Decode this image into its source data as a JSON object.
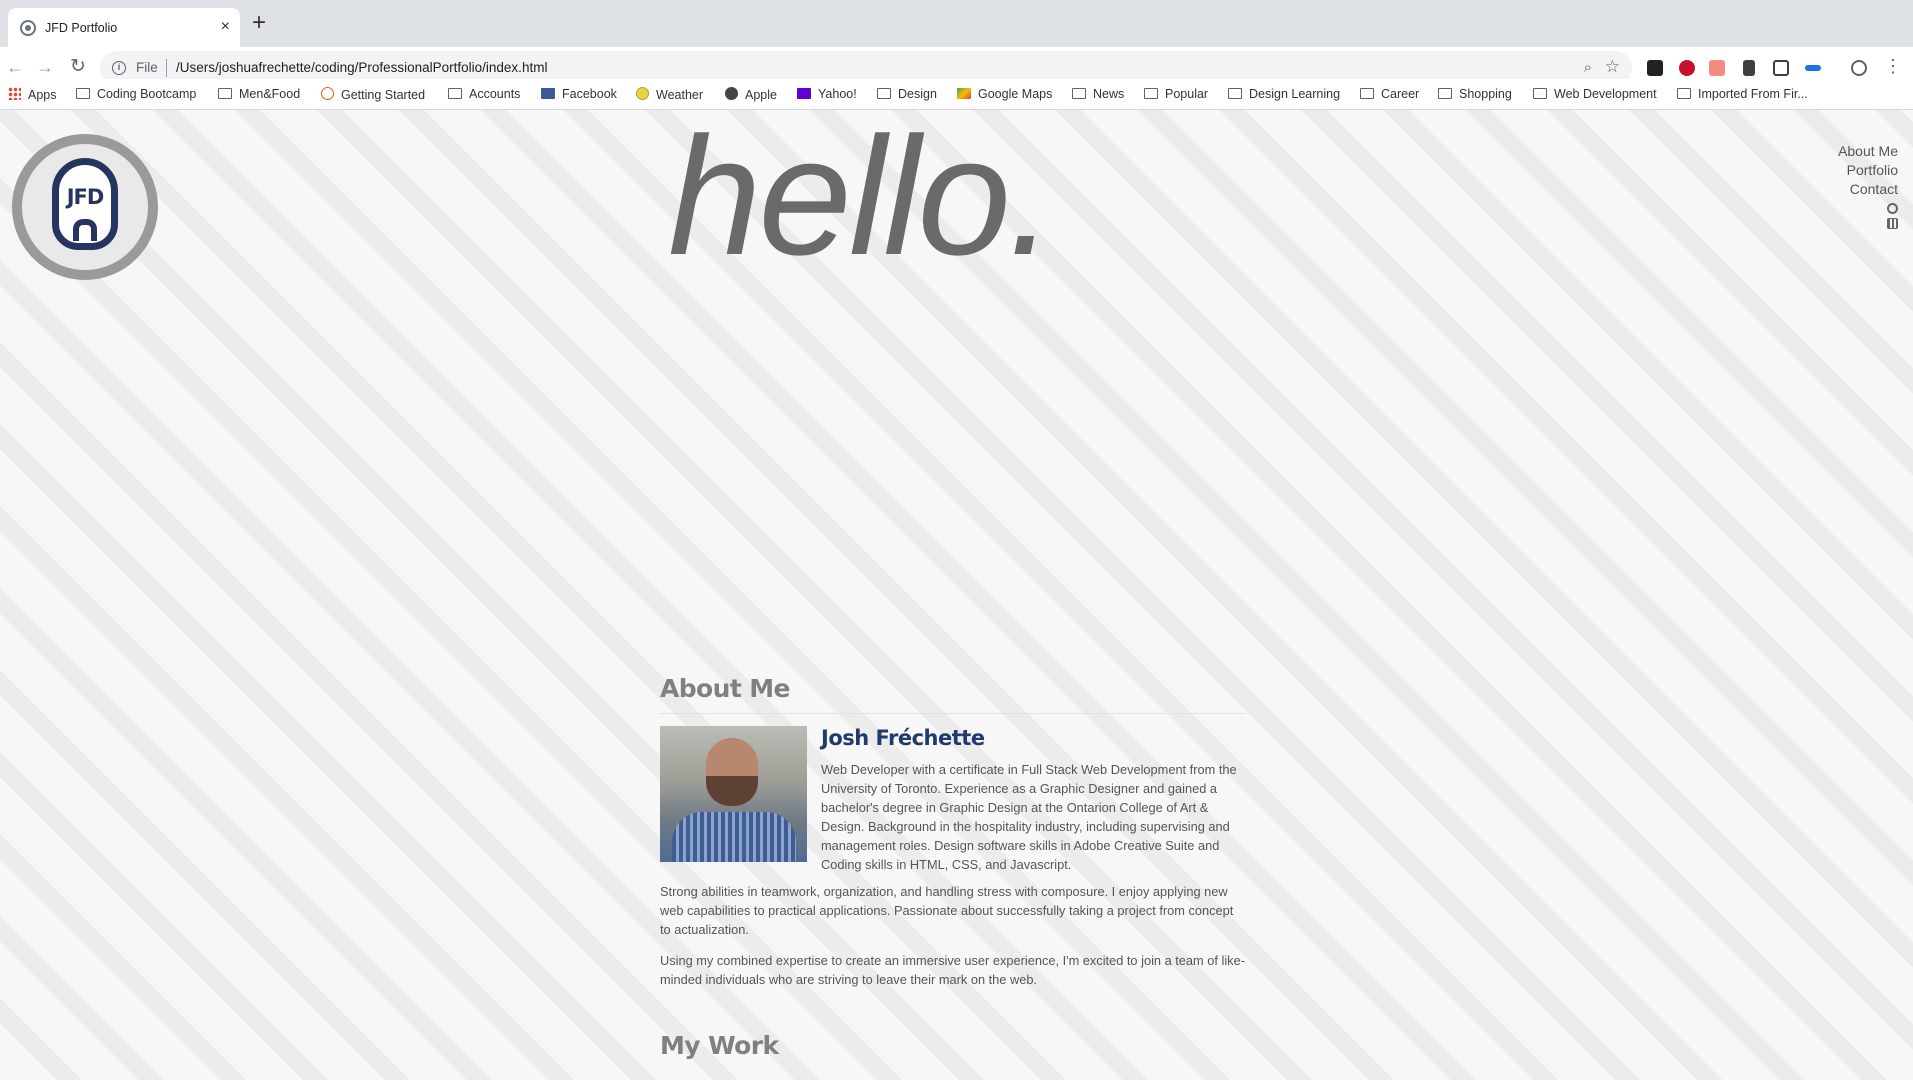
{
  "browser": {
    "tab_title": "JFD Portfolio",
    "close_glyph": "×",
    "new_tab_glyph": "+",
    "address_scheme": "File",
    "address_url": "/Users/joshuafrechette/coding/ProfessionalPortfolio/index.html",
    "bookmarks": [
      {
        "label": "Apps",
        "icon": "apps-grid-icon"
      },
      {
        "label": "Coding Bootcamp",
        "icon": "folder-icon"
      },
      {
        "label": "Men&Food",
        "icon": "folder-icon"
      },
      {
        "label": "Getting Started",
        "icon": "firefox-icon"
      },
      {
        "label": "Accounts",
        "icon": "folder-icon"
      },
      {
        "label": "Facebook",
        "icon": "facebook-icon"
      },
      {
        "label": "Weather",
        "icon": "weather-icon"
      },
      {
        "label": "Apple",
        "icon": "apple-icon"
      },
      {
        "label": "Yahoo!",
        "icon": "yahoo-icon"
      },
      {
        "label": "Design",
        "icon": "folder-icon"
      },
      {
        "label": "Google Maps",
        "icon": "google-maps-icon"
      },
      {
        "label": "News",
        "icon": "folder-icon"
      },
      {
        "label": "Popular",
        "icon": "folder-icon"
      },
      {
        "label": "Design Learning",
        "icon": "folder-icon"
      },
      {
        "label": "Career",
        "icon": "folder-icon"
      },
      {
        "label": "Shopping",
        "icon": "folder-icon"
      },
      {
        "label": "Web Development",
        "icon": "folder-icon"
      },
      {
        "label": "Imported From Fir...",
        "icon": "folder-icon"
      }
    ]
  },
  "page": {
    "logo_text": "JFD",
    "hero": "hello.",
    "nav": {
      "about": "About Me",
      "portfolio": "Portfolio",
      "contact": "Contact"
    },
    "about": {
      "title": "About Me",
      "name": "Josh Fréchette",
      "bio": "Web Developer with a certificate in Full Stack Web Development from the University of Toronto. Experience as a Graphic Designer and gained a bachelor's degree in Graphic Design at the Ontarion College of Art & Design. Background in the hospitality industry, including supervising and management roles. Design software skills in Adobe Creative Suite and Coding skills in HTML, CSS, and Javascript.",
      "paragraph_2": "Strong abilities in teamwork, organization, and handling stress with composure. I enjoy applying new web capabilities to practical applications. Passionate about successfully taking a project from concept to actualization.",
      "paragraph_3": "Using my combined expertise to create an immersive user experience, I'm excited to join a team of like-minded individuals who are striving to leave their mark on the web."
    },
    "work": {
      "title": "My Work"
    }
  },
  "colors": {
    "hero": "#6a6a6a",
    "name": "#1f3a6e",
    "logo": "#26355f"
  }
}
